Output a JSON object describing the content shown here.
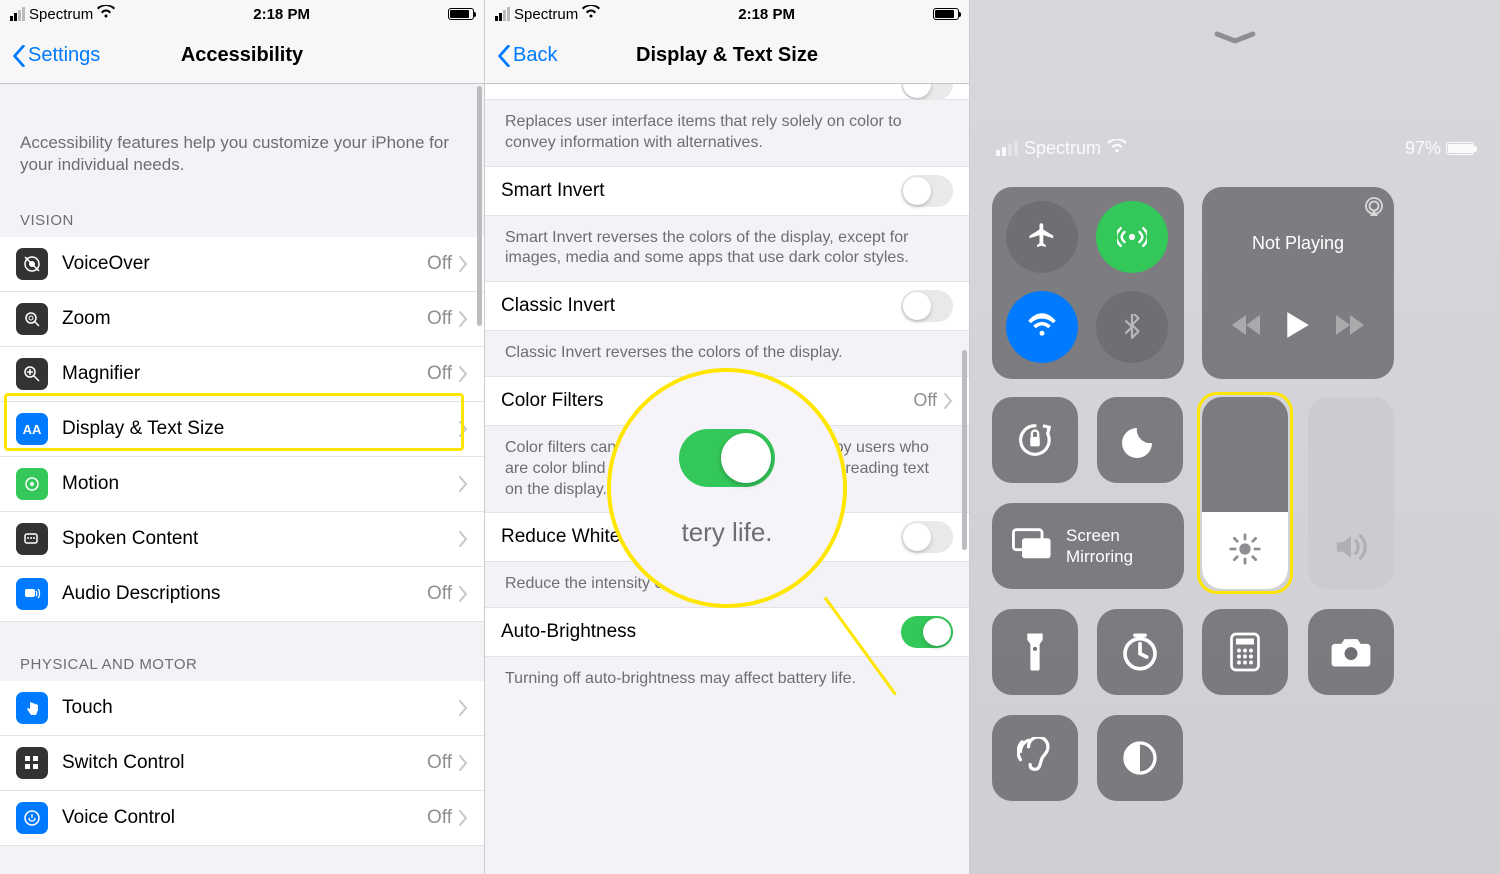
{
  "status": {
    "carrier": "Spectrum",
    "time": "2:18 PM"
  },
  "screen1": {
    "back_label": "Settings",
    "title": "Accessibility",
    "intro": "Accessibility features help you customize your iPhone for your individual needs.",
    "sections": {
      "vision_header": "VISION",
      "physical_header": "PHYSICAL AND MOTOR"
    },
    "vision": [
      {
        "label": "VoiceOver",
        "value": "Off"
      },
      {
        "label": "Zoom",
        "value": "Off"
      },
      {
        "label": "Magnifier",
        "value": "Off"
      },
      {
        "label": "Display & Text Size",
        "value": ""
      },
      {
        "label": "Motion",
        "value": ""
      },
      {
        "label": "Spoken Content",
        "value": ""
      },
      {
        "label": "Audio Descriptions",
        "value": "Off"
      }
    ],
    "physical": [
      {
        "label": "Touch",
        "value": ""
      },
      {
        "label": "Switch Control",
        "value": "Off"
      },
      {
        "label": "Voice Control",
        "value": "Off"
      }
    ]
  },
  "screen2": {
    "back_label": "Back",
    "title": "Display & Text Size",
    "desc0": "Replaces user interface items that rely solely on color to convey information with alternatives.",
    "smart_invert": "Smart Invert",
    "desc1": "Smart Invert reverses the colors of the display, except for images, media and some apps that use dark color styles.",
    "classic_invert": "Classic Invert",
    "desc2": "Classic Invert reverses the colors of the display.",
    "color_filters": "Color Filters",
    "color_filters_value": "Off",
    "desc3": "Color filters can be used to differentiate colors by users who are color blind and aid users who have difficulty reading text on the display.",
    "reduce_white": "Reduce White Point",
    "desc4": "Reduce the intensity of bright colors.",
    "auto_brightness": "Auto-Brightness",
    "desc5": "Turning off auto-brightness may affect battery life.",
    "zoom_text": "tery life."
  },
  "screen3": {
    "carrier": "Spectrum",
    "battery": "97%",
    "not_playing": "Not Playing",
    "mirror_line1": "Screen",
    "mirror_line2": "Mirroring"
  }
}
